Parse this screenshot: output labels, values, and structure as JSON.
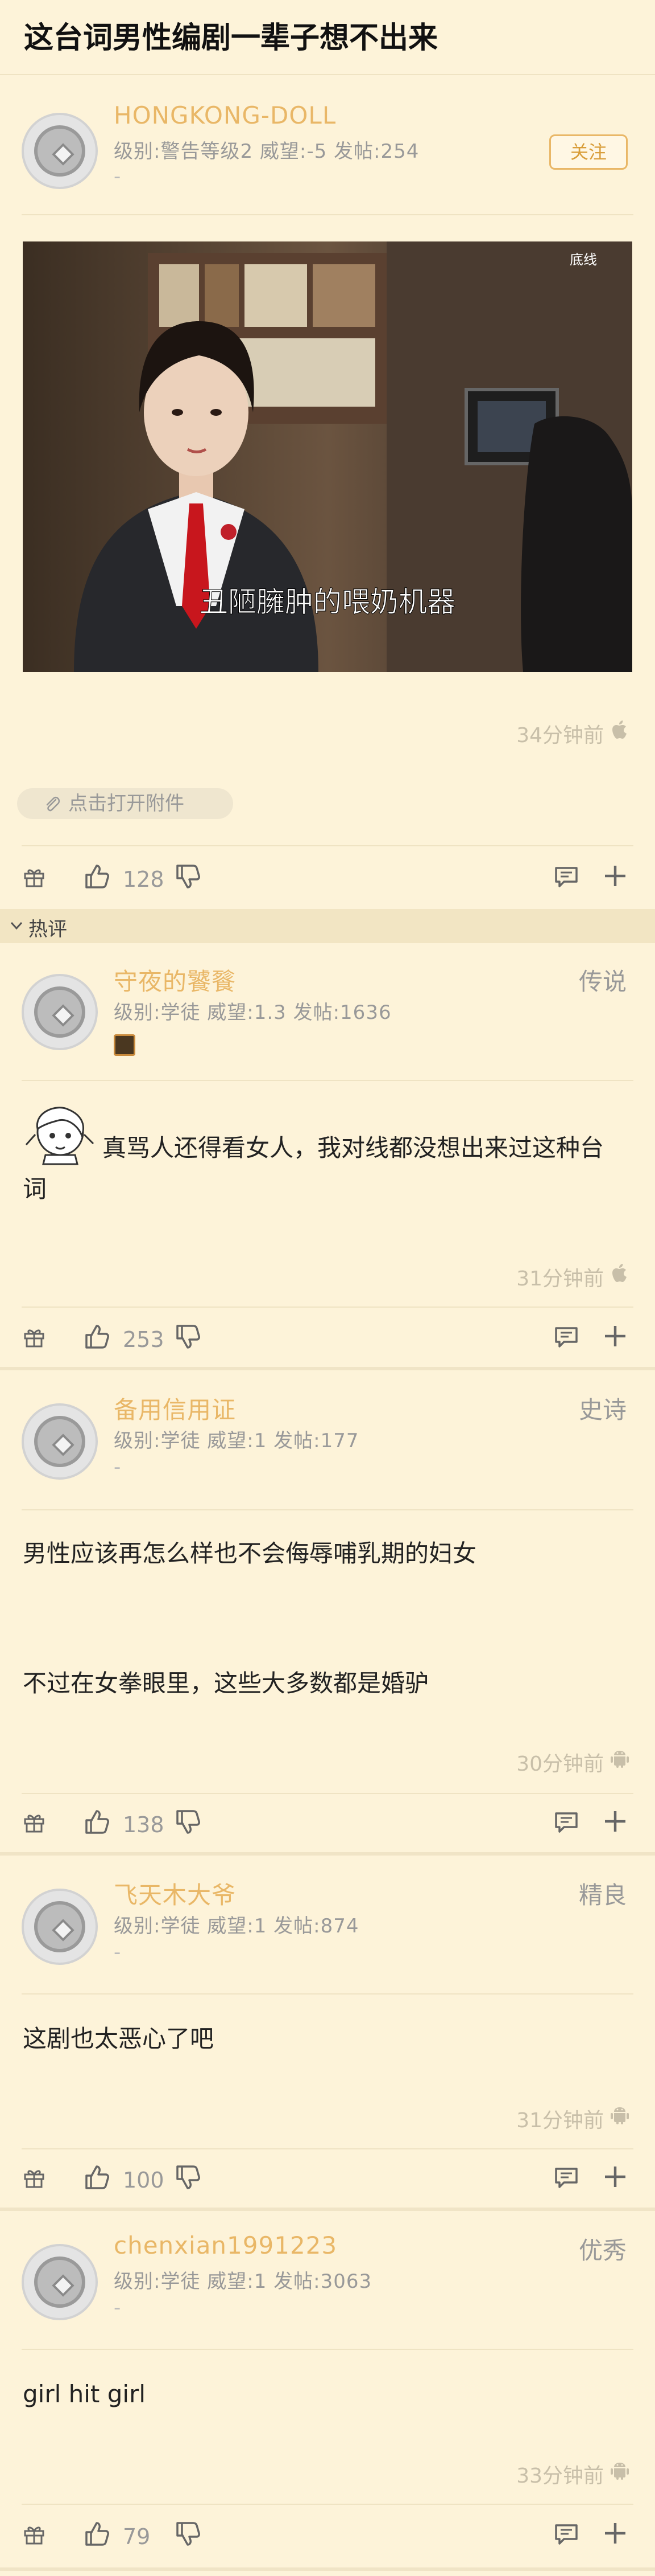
{
  "page": {
    "title": "这台词男性编剧一辈子想不出来"
  },
  "original_post": {
    "username": "HONGKONG-DOLL",
    "meta": "级别:警告等级2 威望:-5 发帖:254",
    "dash": "-",
    "follow_label": "关注",
    "video_watermark": "底线",
    "video_subtitle": "丑陋臃肿的喂奶机器",
    "time": "34分钟前",
    "os_icon": "apple-icon",
    "attachment_label": "点击打开附件",
    "likes": "128"
  },
  "hot_section": {
    "label": "热评"
  },
  "comments": [
    {
      "username": "守夜的饕餮",
      "rank": "传说",
      "meta": "级别:学徒 威望:1.3 发帖:1636",
      "text": "真骂人还得看女人，我对线都没想出来过这种台词",
      "time": "31分钟前",
      "os_icon": "apple-icon",
      "likes": "253"
    },
    {
      "username": "备用信用证",
      "rank": "史诗",
      "meta": "级别:学徒 威望:1 发帖:177",
      "dash": "-",
      "text_lines": [
        "男性应该再怎么样也不会侮辱哺乳期的妇女",
        "不过在女拳眼里，这些大多数都是婚驴"
      ],
      "time": "30分钟前",
      "os_icon": "android-icon",
      "likes": "138"
    },
    {
      "username": "飞天木大爷",
      "rank": "精良",
      "meta": "级别:学徒 威望:1 发帖:874",
      "dash": "-",
      "text": "这剧也太恶心了吧",
      "time": "31分钟前",
      "os_icon": "android-icon",
      "likes": "100"
    },
    {
      "username": "chenxian1991223",
      "rank": "优秀",
      "meta": "级别:学徒 威望:1 发帖:3063",
      "dash": "-",
      "text": "girl hit girl",
      "time": "33分钟前",
      "os_icon": "android-icon",
      "likes": "79"
    }
  ],
  "colors": {
    "background": "#fdf3d9",
    "username": "#e9b767",
    "meta": "#999999",
    "divider": "#efe3c3"
  }
}
